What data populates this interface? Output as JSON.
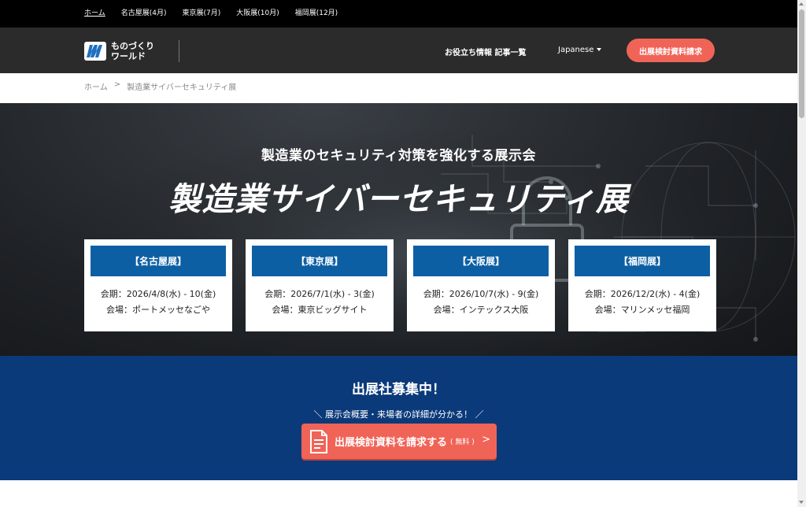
{
  "topbar": {
    "links": [
      "ホーム",
      "名古屋展(4月)",
      "東京展(7月)",
      "大阪展(10月)",
      "福岡展(12月)"
    ]
  },
  "header": {
    "logo_line1": "ものづくり",
    "logo_line2": "ワールド",
    "nav_info": "お役立ち情報 記事一覧",
    "language": "Japanese",
    "cta": "出展検討資料請求"
  },
  "breadcrumb": {
    "home": "ホーム",
    "separator": ">",
    "current": "製造業サイバーセキュリティ展"
  },
  "hero": {
    "subtitle": "製造業のセキュリティ対策を強化する展示会",
    "title": "製造業サイバーセキュリティ展"
  },
  "venues": [
    {
      "name": "【名古屋展】",
      "period": "会期：2026/4/8(水) - 10(金)",
      "place": "会場：ポートメッセなごや"
    },
    {
      "name": "【東京展】",
      "period": "会期：2026/7/1(水) - 3(金)",
      "place": "会場：東京ビッグサイト"
    },
    {
      "name": "【大阪展】",
      "period": "会期：2026/10/7(水) - 9(金)",
      "place": "会場：インテックス大阪"
    },
    {
      "name": "【福岡展】",
      "period": "会期：2026/12/2(水) - 4(金)",
      "place": "会場：マリンメッセ福岡"
    }
  ],
  "recruit": {
    "title": "出展社募集中！",
    "subtitle": "＼ 展示会概要・来場者の詳細が分かる！ ／",
    "button_label": "出展検討資料を請求する",
    "button_note": "( 無料 )",
    "button_arrow": ">"
  },
  "colors": {
    "accent": "#f06458",
    "card_blue": "#0d5fa4",
    "recruit_bg": "#0b3a7a",
    "header_bg": "#2b2b2b"
  }
}
